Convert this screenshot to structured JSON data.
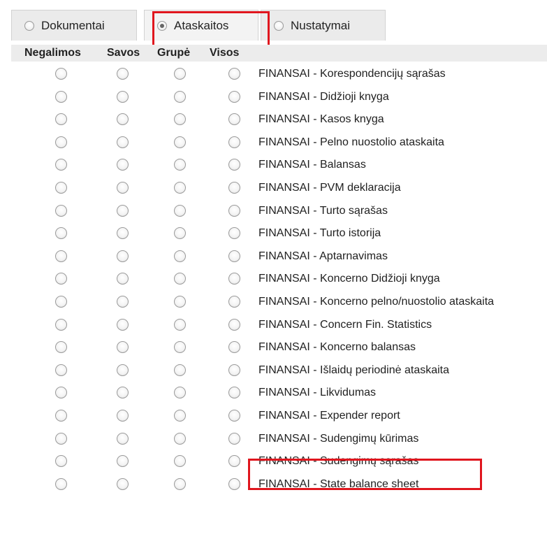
{
  "tabs": [
    {
      "label": "Dokumentai",
      "selected": false
    },
    {
      "label": "Ataskaitos",
      "selected": true
    },
    {
      "label": "Nustatymai",
      "selected": false
    }
  ],
  "columns": [
    "Negalimos",
    "Savos",
    "Grupė",
    "Visos"
  ],
  "reports": [
    "FINANSAI - Korespondencijų sąrašas",
    "FINANSAI - Didžioji knyga",
    "FINANSAI - Kasos knyga",
    "FINANSAI - Pelno nuostolio ataskaita",
    "FINANSAI - Balansas",
    "FINANSAI - PVM deklaracija",
    "FINANSAI - Turto sąrašas",
    "FINANSAI - Turto istorija",
    "FINANSAI - Aptarnavimas",
    "FINANSAI - Koncerno Didžioji knyga",
    "FINANSAI - Koncerno pelno/nuostolio ataskaita",
    "FINANSAI - Concern Fin. Statistics",
    "FINANSAI - Koncerno balansas",
    "FINANSAI - Išlaidų periodinė ataskaita",
    "FINANSAI - Likvidumas",
    "FINANSAI - Expender report",
    "FINANSAI - Sudengimų kūrimas",
    "FINANSAI - Sudengimų sąrašas",
    "FINANSAI - State balance sheet"
  ],
  "colors": {
    "highlight": "#e0161e",
    "tab_bg": "#ebebeb"
  }
}
